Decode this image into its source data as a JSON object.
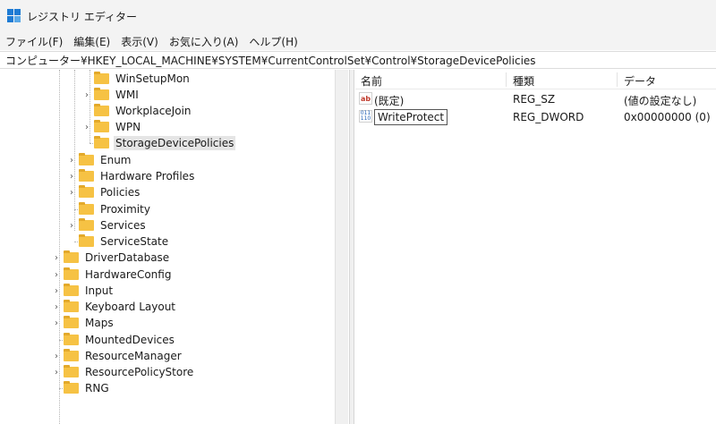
{
  "window": {
    "title": "レジストリ エディター",
    "icon": "registry-editor-icon"
  },
  "menu": [
    "ファイル(F)",
    "編集(E)",
    "表示(V)",
    "お気に入り(A)",
    "ヘルプ(H)"
  ],
  "address": "コンピューター¥HKEY_LOCAL_MACHINE¥SYSTEM¥CurrentControlSet¥Control¥StorageDevicePolicies",
  "tree": [
    {
      "label": "WinSetupMon",
      "expandable": false
    },
    {
      "label": "WMI",
      "expandable": true
    },
    {
      "label": "WorkplaceJoin",
      "expandable": false
    },
    {
      "label": "WPN",
      "expandable": true
    },
    {
      "label": "StorageDevicePolicies",
      "expandable": false,
      "selected": true
    },
    {
      "label": "Enum",
      "expandable": true
    },
    {
      "label": "Hardware Profiles",
      "expandable": true
    },
    {
      "label": "Policies",
      "expandable": true
    },
    {
      "label": "Proximity",
      "expandable": false
    },
    {
      "label": "Services",
      "expandable": true
    },
    {
      "label": "ServiceState",
      "expandable": false
    },
    {
      "label": "DriverDatabase",
      "expandable": true
    },
    {
      "label": "HardwareConfig",
      "expandable": true
    },
    {
      "label": "Input",
      "expandable": true
    },
    {
      "label": "Keyboard Layout",
      "expandable": true
    },
    {
      "label": "Maps",
      "expandable": true
    },
    {
      "label": "MountedDevices",
      "expandable": false
    },
    {
      "label": "ResourceManager",
      "expandable": true
    },
    {
      "label": "ResourcePolicyStore",
      "expandable": true
    },
    {
      "label": "RNG",
      "expandable": false
    }
  ],
  "list": {
    "headers": {
      "name": "名前",
      "type": "種類",
      "data": "データ"
    },
    "rows": [
      {
        "icon": "string-value-icon",
        "badge": "ab",
        "name": "(既定)",
        "type": "REG_SZ",
        "data": "(値の設定なし)"
      },
      {
        "icon": "binary-value-icon",
        "badge": "011\n110",
        "name": "WriteProtect",
        "type": "REG_DWORD",
        "data": "0x00000000 (0)"
      }
    ]
  }
}
